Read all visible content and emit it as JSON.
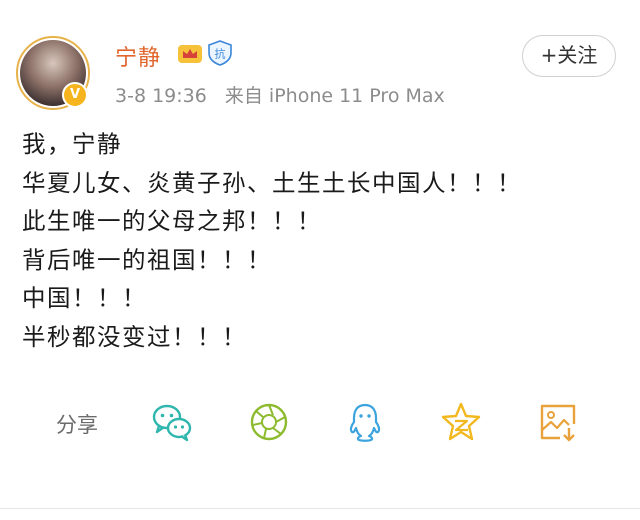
{
  "profile": {
    "username": "宁静",
    "avatar_icon": "avatar-portrait",
    "verified_badge": "V",
    "meta_date": "3-8 19:36",
    "meta_source": "来自 iPhone 11 Pro Max"
  },
  "badges": {
    "crown_icon": "crown-icon",
    "kang_label": "抗"
  },
  "actions": {
    "follow_label": "+关注"
  },
  "post": {
    "lines": [
      "我，宁静",
      "华夏儿女、炎黄子孙、土生土长中国人！！！",
      "此生唯一的父母之邦！！！",
      "背后唯一的祖国！！！",
      "中国！！！",
      "半秒都没变过！！！"
    ]
  },
  "share": {
    "label": "分享",
    "icons": [
      "wechat-icon",
      "moments-icon",
      "qq-icon",
      "qzone-star-icon",
      "save-image-icon"
    ]
  },
  "colors": {
    "username": "#e0652d",
    "share_icon": "#2fb7ae",
    "star": "#f2b81f"
  }
}
